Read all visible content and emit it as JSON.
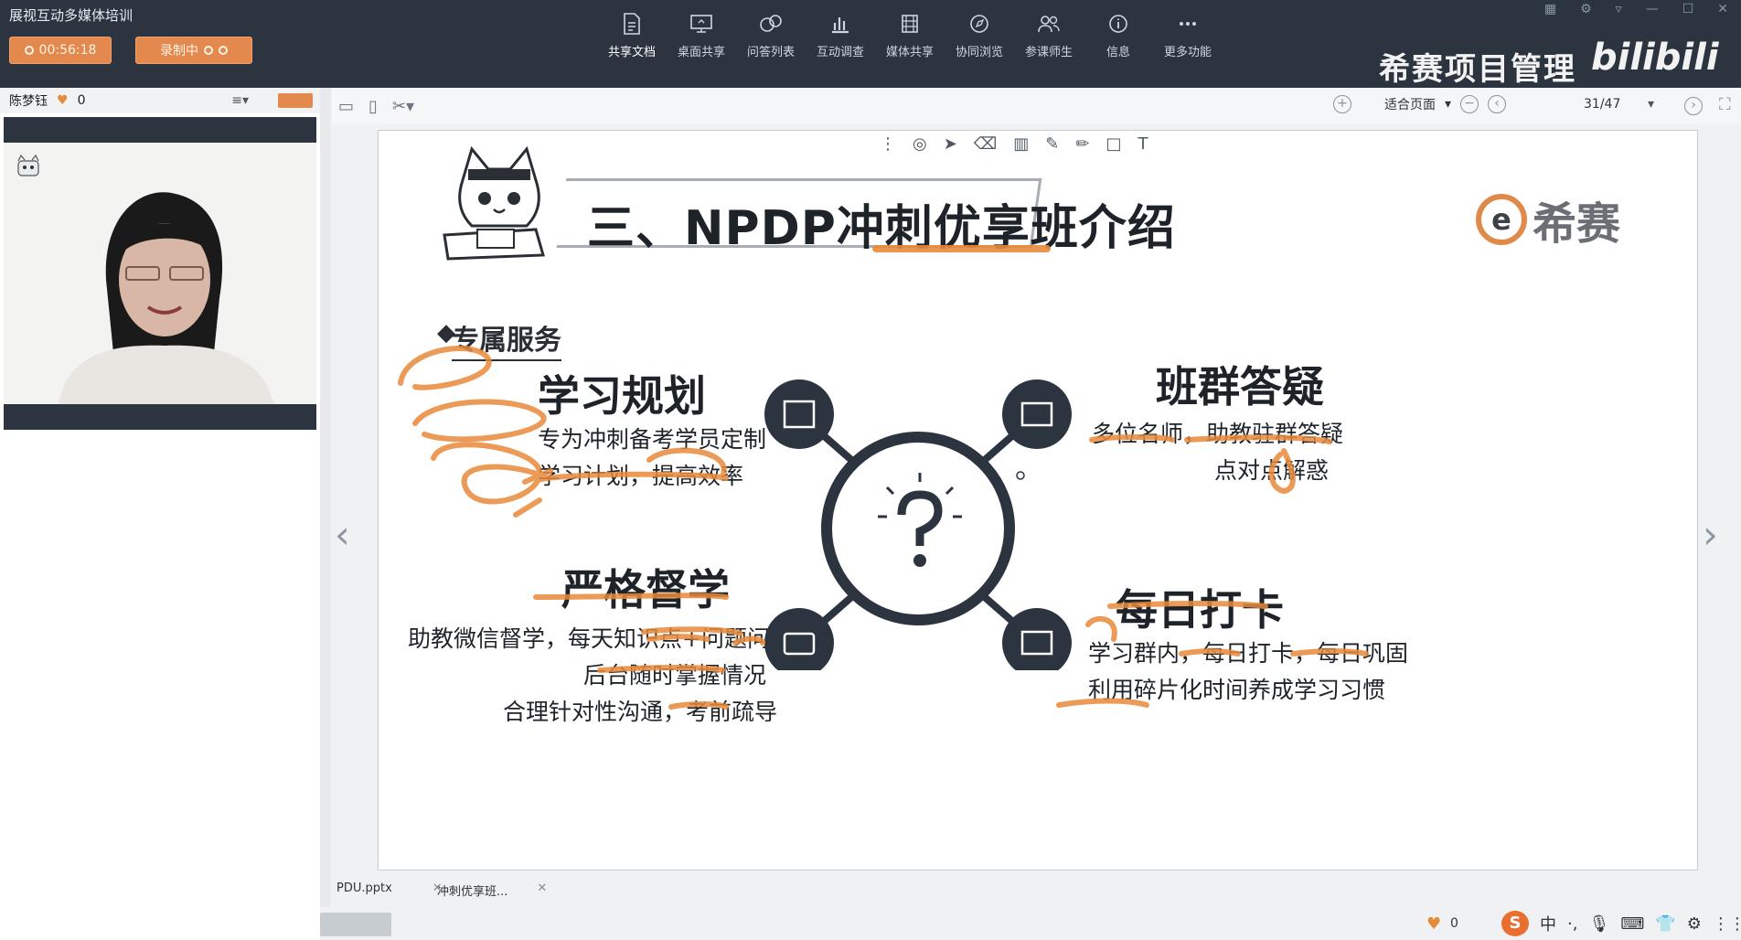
{
  "app": {
    "title": "展视互动多媒体培训",
    "timer_label": "00:56:18",
    "recording_label": "录制中",
    "brand_text": "希赛项目管理",
    "brand_logo": "bilibili"
  },
  "toolbar": {
    "items": [
      {
        "label": "共享文档",
        "icon": "document-icon"
      },
      {
        "label": "桌面共享",
        "icon": "desktop-share-icon"
      },
      {
        "label": "问答列表",
        "icon": "qa-list-icon"
      },
      {
        "label": "互动调查",
        "icon": "survey-icon"
      },
      {
        "label": "媒体共享",
        "icon": "media-share-icon"
      },
      {
        "label": "协同浏览",
        "icon": "cobrowse-icon"
      },
      {
        "label": "参课师生",
        "icon": "participants-icon"
      },
      {
        "label": "信息",
        "icon": "info-icon"
      },
      {
        "label": "更多功能",
        "icon": "more-icon"
      }
    ]
  },
  "user": {
    "name": "陈梦钰",
    "likes": "0"
  },
  "doc_toolbar": {
    "zoom_label": "适合页面",
    "page_counter": "31/47"
  },
  "slide": {
    "title": "三、NPDP冲刺优享班介绍",
    "logo_text": "希赛",
    "subtitle": "专属服务",
    "sections": {
      "study_plan": {
        "heading": "学习规划",
        "line1": "专为冲刺备考学员定制",
        "line2": "学习计划，提高效率"
      },
      "group_qa": {
        "heading": "班群答疑",
        "line1": "多位名师，助教驻群答疑",
        "line2": "点对点解惑"
      },
      "strict": {
        "heading": "严格督学",
        "line1": "助教微信督学，每天知识点+问题问候",
        "line2": "后台随时掌握情况",
        "line3": "合理针对性沟通，考前疏导"
      },
      "checkin": {
        "heading": "每日打卡",
        "line1": "学习群内，每日打卡，每日巩固",
        "line2": "利用碎片化时间养成学习习惯"
      }
    }
  },
  "bottom_tabs": {
    "tab1": "PDU.pptx",
    "tab2": "冲刺优享班..."
  },
  "status": {
    "likes": "0",
    "ime_lang": "中"
  },
  "colors": {
    "chrome": "#2c3440",
    "accent_orange": "#e3894e",
    "annotation": "#e88a3a",
    "hub_dark": "#2c3440"
  }
}
